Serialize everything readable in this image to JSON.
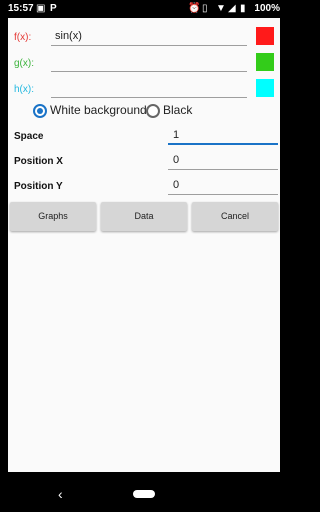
{
  "status": {
    "time": "15:57",
    "battery": "100%"
  },
  "functions": [
    {
      "label": "f(x):",
      "value": "sin(x)",
      "label_color": "#e53935",
      "swatch_color": "#ff1a1a"
    },
    {
      "label": "g(x):",
      "value": "",
      "label_color": "#3cb43c",
      "swatch_color": "#33cc1a"
    },
    {
      "label": "h(x):",
      "value": "",
      "label_color": "#22b8e0",
      "swatch_color": "#00ffff"
    }
  ],
  "background": {
    "white_label": "White background",
    "black_label": "Black",
    "selected": "white"
  },
  "settings": [
    {
      "label": "Space",
      "value": "1"
    },
    {
      "label": "Position X",
      "value": "0"
    },
    {
      "label": "Position Y",
      "value": "0"
    }
  ],
  "buttons": {
    "graphs": "Graphs",
    "data": "Data",
    "cancel": "Cancel"
  },
  "icons": [
    "image-icon",
    "p-app-icon",
    "alarm-icon",
    "vibrate-icon",
    "wifi-icon",
    "signal-icon",
    "battery-icon",
    "back-icon",
    "home-icon"
  ]
}
